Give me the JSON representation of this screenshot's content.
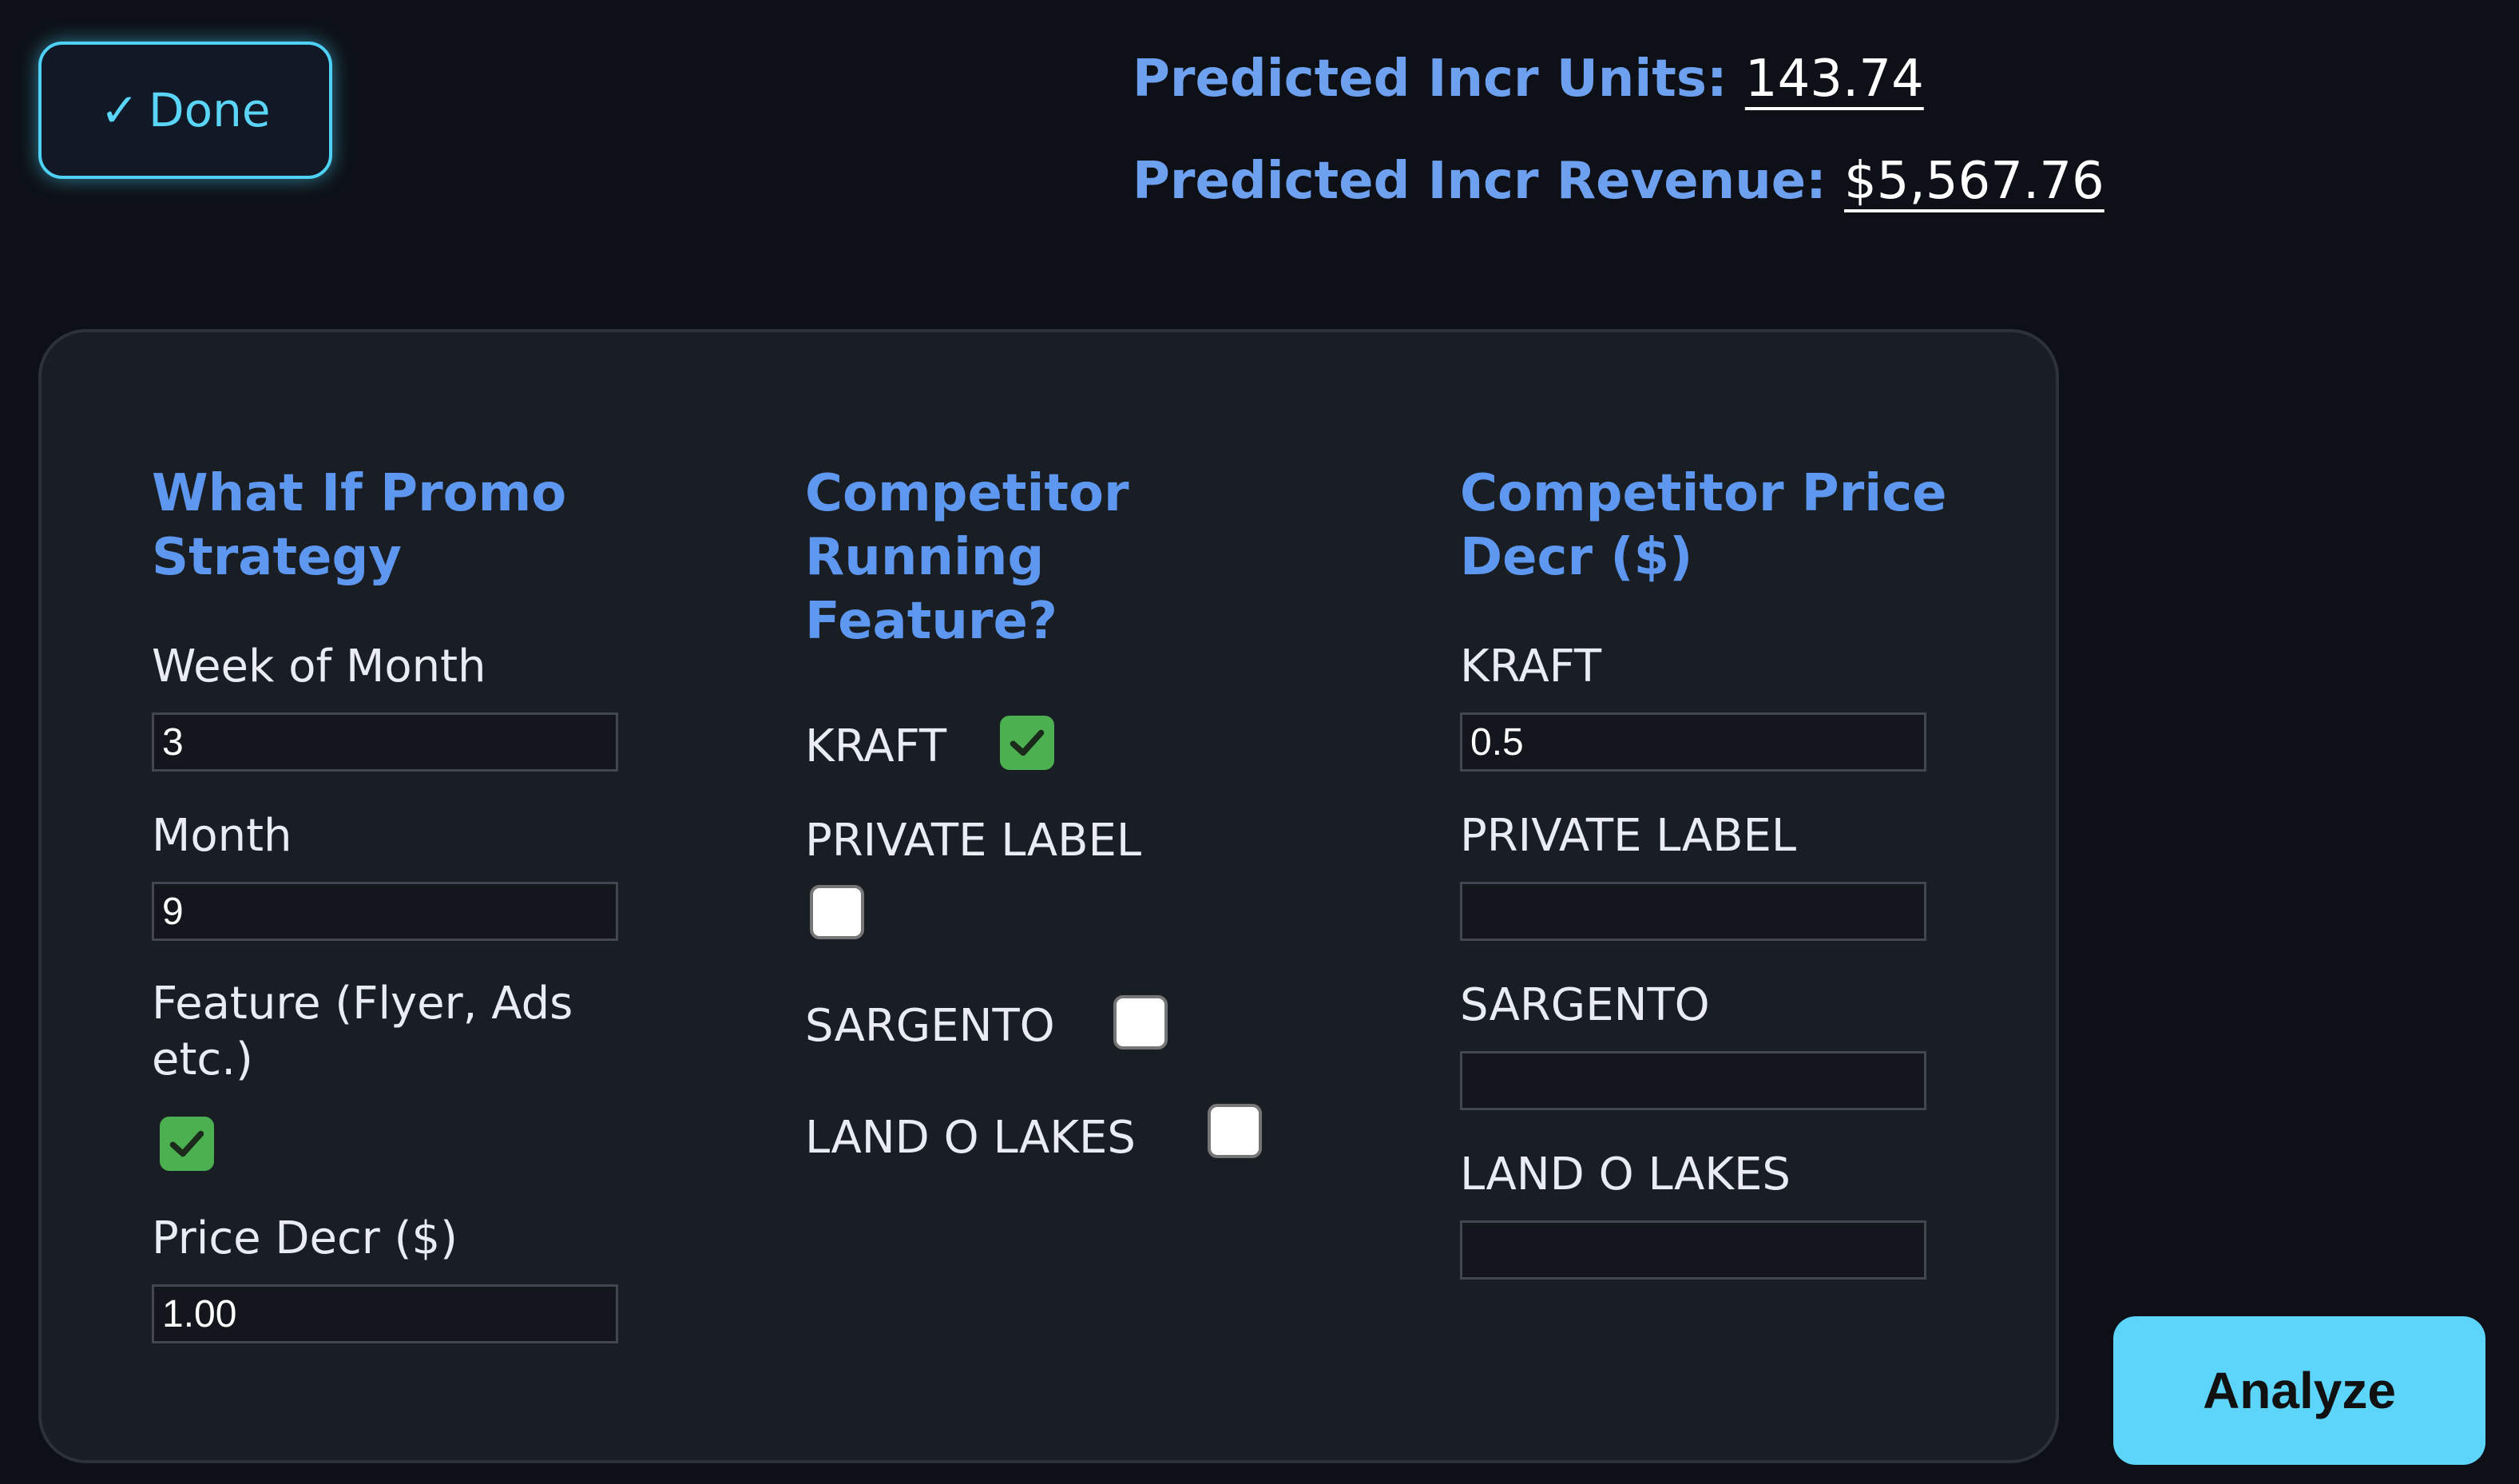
{
  "header": {
    "done_check": "✓",
    "done_label": "Done",
    "units_label": "Predicted Incr Units:",
    "units_value": "143.74",
    "revenue_label": "Predicted Incr Revenue:",
    "revenue_value": "$5,567.76"
  },
  "promo": {
    "title": "What If Promo Strategy",
    "week_label": "Week of Month",
    "week_value": "3",
    "month_label": "Month",
    "month_value": "9",
    "feature_label": "Feature (Flyer, Ads etc.)",
    "feature_checked": true,
    "price_label": "Price Decr ($)",
    "price_value": "1.00"
  },
  "competitor_feature": {
    "title": "Competitor Running Feature?",
    "items": [
      {
        "label": "KRAFT",
        "checked": true
      },
      {
        "label": "PRIVATE LABEL",
        "checked": false
      },
      {
        "label": "SARGENTO",
        "checked": false
      },
      {
        "label": "LAND O LAKES",
        "checked": false
      }
    ]
  },
  "competitor_price": {
    "title": "Competitor Price Decr ($)",
    "items": [
      {
        "label": "KRAFT",
        "value": "0.5"
      },
      {
        "label": "PRIVATE LABEL",
        "value": ""
      },
      {
        "label": "SARGENTO",
        "value": ""
      },
      {
        "label": "LAND O LAKES",
        "value": ""
      }
    ]
  },
  "actions": {
    "analyze_label": "Analyze"
  },
  "colors": {
    "background": "#0d1117",
    "panel": "#191d24",
    "accent_cyan": "#5dd5fb",
    "heading_blue": "#5e97ef",
    "checkbox_green": "#4caf50"
  }
}
